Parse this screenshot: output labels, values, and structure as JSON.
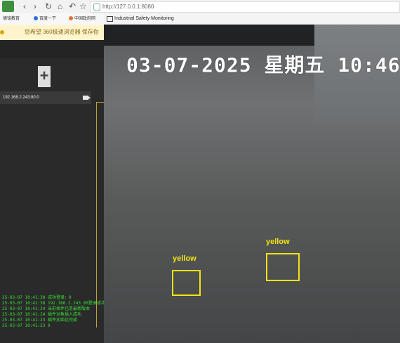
{
  "browser": {
    "url": "http://127.0.0.1:8080",
    "bookmarks": [
      "德铭教育",
      "百度一下",
      "中国政府网"
    ],
    "notice": "您希望 360极速浏览器 保存你"
  },
  "window": {
    "title": "Industrial Safety Monitoring"
  },
  "left_panel": {
    "add_label": "+",
    "device_ip": "192.168.2.243:80:0",
    "log_lines": [
      "25-03-07 10:41:38 成功登录：0",
      "25-03-07 10:41:38 192.168.2.243_80登录成功",
      "25-03-07 10:41:24 当前插件已是最新版本",
      "25-03-07 10:41:24 插件对象插入成功",
      "25-03-07 10:41:23 插件初始化完成",
      "25-03-07 10:41:23 0"
    ]
  },
  "video": {
    "osd": "03-07-2025 星期五 10:46",
    "detections": [
      {
        "label": "yellow"
      },
      {
        "label": "yellow"
      }
    ]
  },
  "colors": {
    "detection": "#f2e413",
    "log": "#36e136"
  }
}
